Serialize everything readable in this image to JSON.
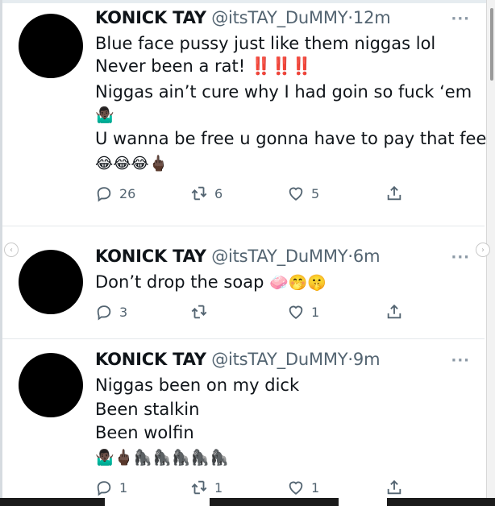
{
  "tweets": [
    {
      "name": "KONICK TAY",
      "handle": "@itsTAY_DuMMY",
      "dot": "·",
      "time": "12m",
      "more": "···",
      "lines": [
        "Blue face pussy just like them niggas lol",
        "Never been a rat! ",
        "Niggas ain’t cure why I had goin so fuck ‘em",
        "🤷🏿‍♂️",
        "U wanna be free u gonna have to pay that fee",
        "😂😂😂🖕🏿"
      ],
      "bangs": "‼️‼️‼️",
      "replies": "26",
      "retweets": "6",
      "likes": "5"
    },
    {
      "name": "KONICK TAY",
      "handle": "@itsTAY_DuMMY",
      "dot": "·",
      "time": "6m",
      "more": "···",
      "lines": [
        "Don’t drop the soap ",
        "🧼🤭🤫"
      ],
      "replies": "3",
      "retweets": "",
      "likes": "1"
    },
    {
      "name": "KONICK TAY",
      "handle": "@itsTAY_DuMMY",
      "dot": "·",
      "time": "9m",
      "more": "···",
      "lines": [
        "Niggas been on my dick",
        "Been stalkin",
        "Been wolfin",
        "🤷🏿‍♂️🖕🏿🦍🦍🦍🦍🦍"
      ],
      "replies": "1",
      "retweets": "1",
      "likes": "1"
    }
  ],
  "nav": {
    "prev_icon": "‹",
    "next_icon": "›"
  },
  "colors": {
    "bang": "#e0121c",
    "muted": "#536471",
    "text": "#0f1419"
  }
}
